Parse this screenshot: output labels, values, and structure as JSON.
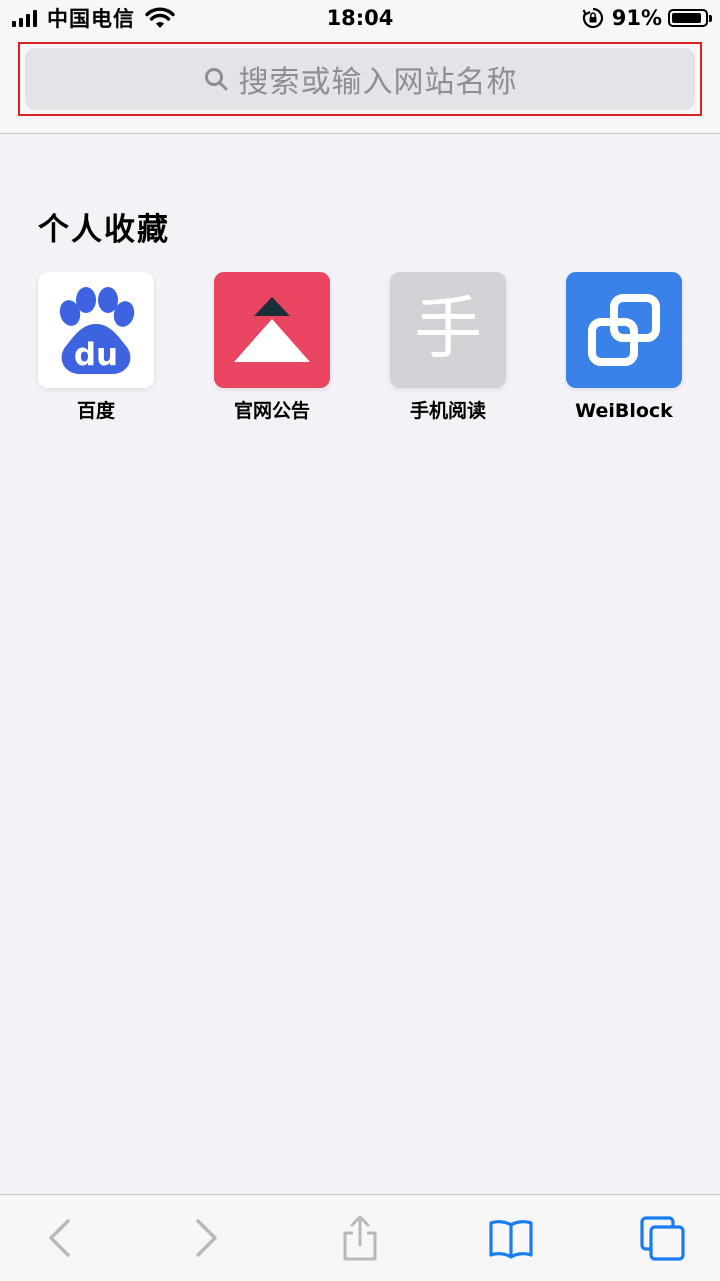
{
  "status_bar": {
    "carrier": "中国电信",
    "time": "18:04",
    "battery_percent": "91%",
    "icons": [
      "signal-icon",
      "wifi-icon",
      "rotation-lock-icon",
      "battery-icon"
    ]
  },
  "address_bar": {
    "placeholder": "搜索或输入网站名称",
    "icon": "search-icon"
  },
  "favorites": {
    "title": "个人收藏",
    "items": [
      {
        "label": "百度",
        "icon": "baidu-paw-icon",
        "color": "#ffffff"
      },
      {
        "label": "官网公告",
        "icon": "triangle-logo-icon",
        "color": "#e94560"
      },
      {
        "label": "手机阅读",
        "icon": "letter-icon",
        "letter": "手",
        "color": "#d1d1d6"
      },
      {
        "label": "WeiBlock",
        "icon": "linked-squares-icon",
        "color": "#3a82e9"
      }
    ]
  },
  "toolbar": {
    "items": [
      {
        "name": "back-icon",
        "enabled": false
      },
      {
        "name": "forward-icon",
        "enabled": false
      },
      {
        "name": "share-icon",
        "enabled": false
      },
      {
        "name": "bookmarks-icon",
        "enabled": true
      },
      {
        "name": "tabs-icon",
        "enabled": true
      }
    ],
    "accent_color": "#1a7cf5",
    "disabled_color": "#b8b8bd"
  }
}
